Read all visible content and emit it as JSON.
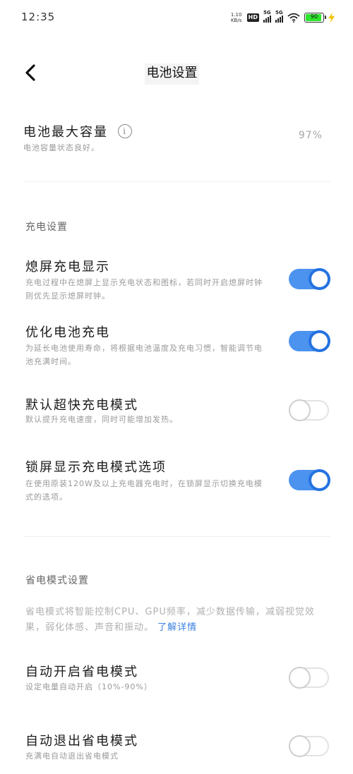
{
  "status_bar": {
    "time": "12:35",
    "net_speed_value": "1.10",
    "net_speed_unit": "KB/s",
    "hd_label": "HD",
    "sim1_label": "5G",
    "sim2_label": "5G",
    "battery_level": "90",
    "battery_color": "#2ee62e"
  },
  "header": {
    "back_icon": "chevron-left-icon",
    "title": "电池设置"
  },
  "capacity": {
    "title": "电池最大容量",
    "subtitle": "电池容量状态良好。",
    "value": "97%",
    "info_glyph": "i"
  },
  "charging": {
    "section_title": "充电设置",
    "items": [
      {
        "title": "熄屏充电显示",
        "desc": "充电过程中在熄屏上显示充电状态和图标，若同时开启熄屏时钟则优先显示熄屏时钟。",
        "enabled": true
      },
      {
        "title": "优化电池充电",
        "desc": "为延长电池使用寿命，将根据电池温度及充电习惯，智能调节电池充满时间。",
        "enabled": true
      },
      {
        "title": "默认超快充电模式",
        "desc": "默认提升充电速度，同时可能增加发热。",
        "enabled": false
      },
      {
        "title": "锁屏显示充电模式选项",
        "desc": "在使用原装120W及以上充电器充电时，在锁屏显示切换充电模式的选项。",
        "enabled": true
      }
    ]
  },
  "power_saving": {
    "section_title": "省电模式设置",
    "description": "省电模式将智能控制CPU、GPU频率，减少数据传输，减弱视觉效果，弱化体感、声音和振动。",
    "learn_more": "了解详情",
    "items": [
      {
        "title": "自动开启省电模式",
        "desc": "设定电量自动开启（10%-90%）",
        "enabled": false
      },
      {
        "title": "自动退出省电模式",
        "desc": "充满电自动退出省电模式",
        "enabled": false
      }
    ]
  },
  "colors": {
    "accent": "#2573e0",
    "toggle_on_track": "#4b93ef",
    "toggle_off_border": "#e3e3e3",
    "link": "#3a7fe0"
  }
}
